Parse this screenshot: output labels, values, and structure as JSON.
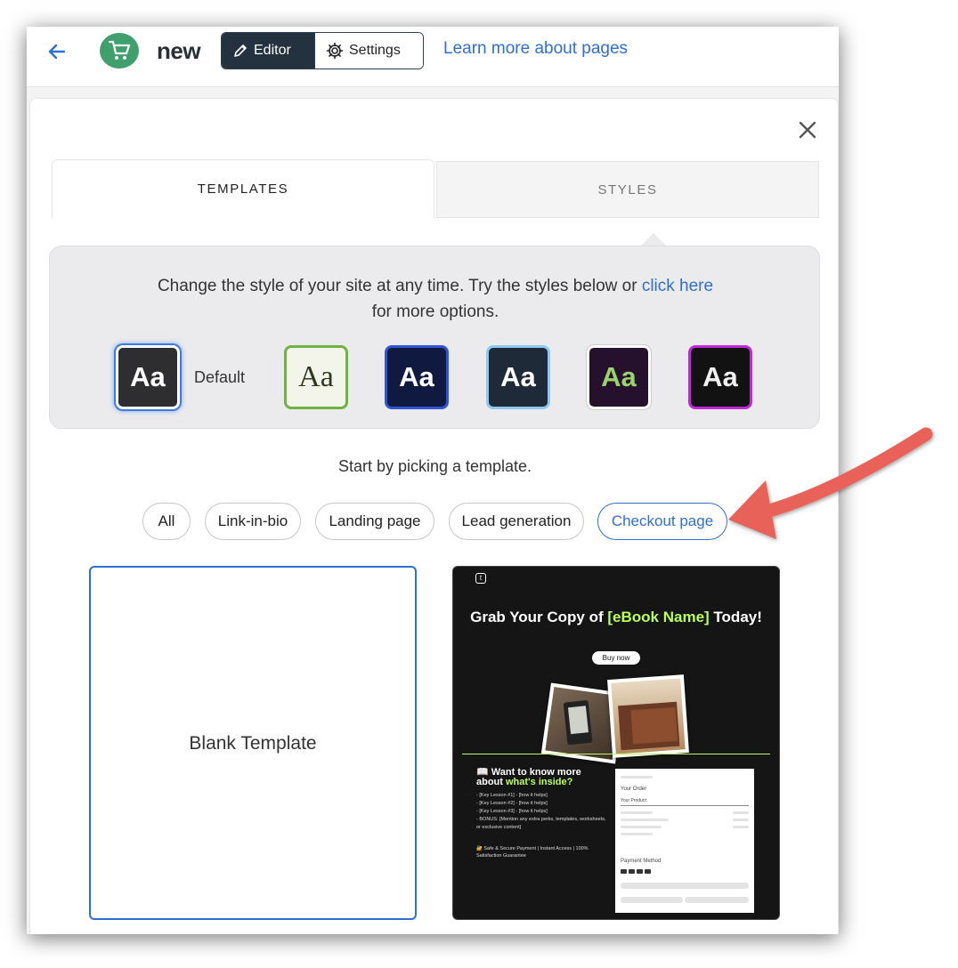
{
  "header": {
    "page_name": "new",
    "editor_label": "Editor",
    "settings_label": "Settings",
    "learn_more": "Learn more about pages"
  },
  "tabs": {
    "templates": "TEMPLATES",
    "styles": "STYLES"
  },
  "styles": {
    "message_before": "Change the style of your site at any time. Try the styles below or ",
    "message_link": "click here",
    "message_after": "for more options.",
    "default_label": "Default",
    "swatch_text": "Aa"
  },
  "templates": {
    "prompt": "Start by picking a template.",
    "filters": [
      "All",
      "Link-in-bio",
      "Landing page",
      "Lead generation",
      "Checkout page"
    ],
    "active_filter": "Checkout page",
    "blank_label": "Blank Template"
  },
  "thumbnail": {
    "logo": "t",
    "headline_1": "Grab Your Copy of ",
    "headline_hl": "[eBook Name]",
    "headline_2": " Today!",
    "buy_now": "Buy now",
    "know_1": "📖 Want to know more about ",
    "know_hl": "what's inside?",
    "lessons": [
      "[Key Lesson #1] - [how it helps]",
      "[Key Lesson #2] - [how it helps]",
      "[Key Lesson #3] - [how it helps]",
      "BONUS: [Mention any extra perks, templates, worksheets, or exclusive content]"
    ],
    "safe": "🔐 Safe & Secure Payment | Instant Access | 100% Satisfaction Guarantee",
    "your_order": "Your Order",
    "your_product": "Your Product:",
    "payment_method": "Payment Method"
  },
  "colors": {
    "accent": "#2f6fd0",
    "brand_green": "#3f9f6d",
    "annotation_arrow": "#e8625a"
  }
}
